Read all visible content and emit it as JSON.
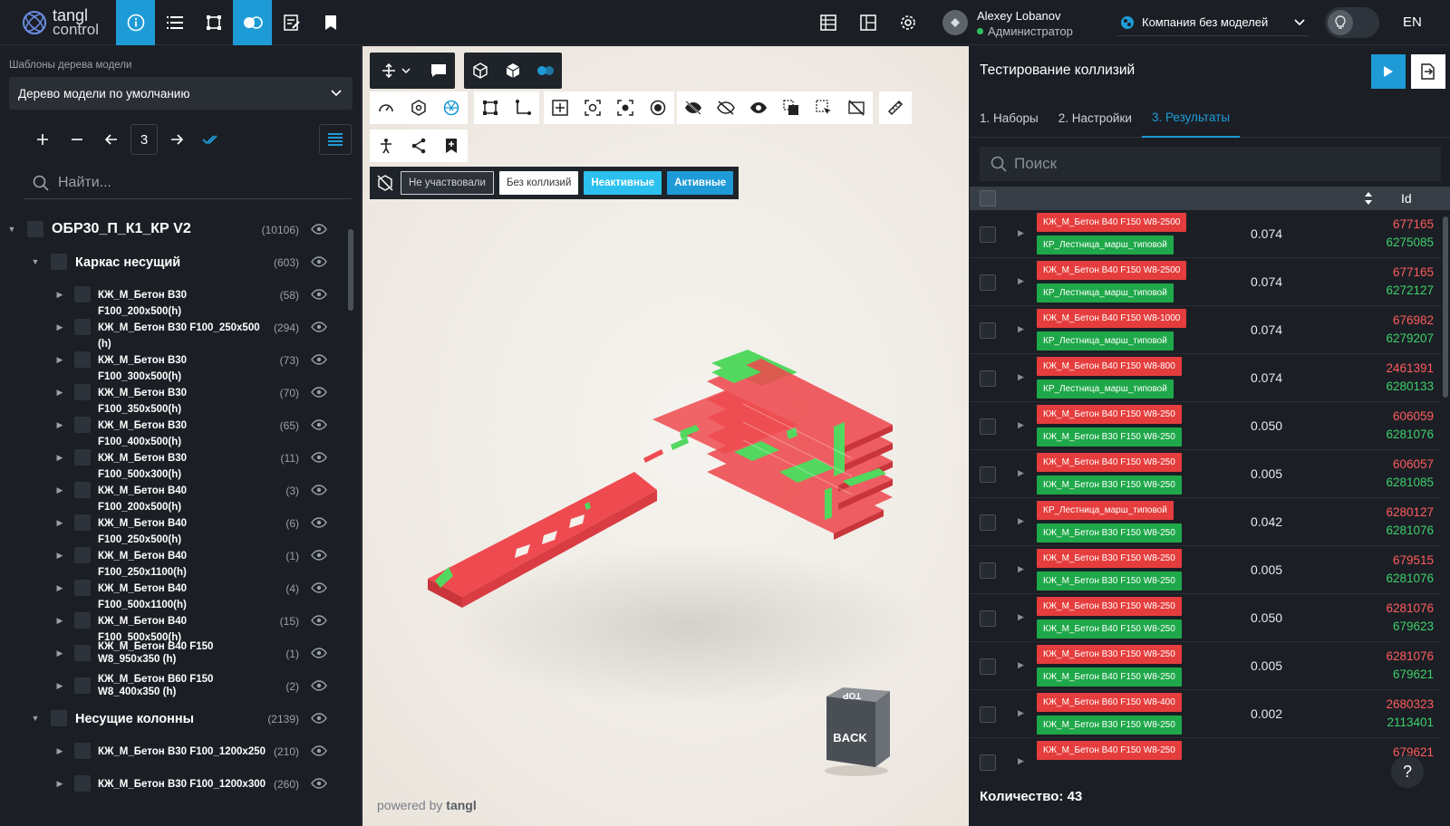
{
  "app": {
    "logo_line1": "tangl",
    "logo_line2": "control"
  },
  "user": {
    "name": "Alexey Lobanov",
    "role": "Администратор"
  },
  "company": "Компания без моделей",
  "lang": "EN",
  "left": {
    "template_label": "Шаблоны дерева модели",
    "template_value": "Дерево модели по умолчанию",
    "level": "3",
    "search_placeholder": "Найти...",
    "tree": [
      {
        "depth": 0,
        "label": "ОБР30_П_К1_КР V2",
        "count": "(10106)"
      },
      {
        "depth": 1,
        "label": "Каркас несущий",
        "count": "(603)"
      },
      {
        "depth": 2,
        "label": "КЖ_М_Бетон В30 F100_200x500(h)",
        "count": "(58)"
      },
      {
        "depth": 2,
        "label": "КЖ_М_Бетон В30 F100_250x500 (h)",
        "count": "(294)"
      },
      {
        "depth": 2,
        "label": "КЖ_М_Бетон В30 F100_300x500(h)",
        "count": "(73)"
      },
      {
        "depth": 2,
        "label": "КЖ_М_Бетон В30 F100_350x500(h)",
        "count": "(70)"
      },
      {
        "depth": 2,
        "label": "КЖ_М_Бетон В30 F100_400x500(h)",
        "count": "(65)"
      },
      {
        "depth": 2,
        "label": "КЖ_М_Бетон В30 F100_500x300(h)",
        "count": "(11)"
      },
      {
        "depth": 2,
        "label": "КЖ_М_Бетон В40 F100_200x500(h)",
        "count": "(3)"
      },
      {
        "depth": 2,
        "label": "КЖ_М_Бетон В40 F100_250x500(h)",
        "count": "(6)"
      },
      {
        "depth": 2,
        "label": "КЖ_М_Бетон В40 F100_250x1100(h)",
        "count": "(1)"
      },
      {
        "depth": 2,
        "label": "КЖ_М_Бетон В40 F100_500x1100(h)",
        "count": "(4)"
      },
      {
        "depth": 2,
        "label": "КЖ_М_Бетон В40 F100_500x500(h)",
        "count": "(15)"
      },
      {
        "depth": 2,
        "label": "КЖ_М_Бетон В40 F150 W8_950x350 (h)",
        "count": "(1)"
      },
      {
        "depth": 2,
        "label": "КЖ_М_Бетон В60 F150 W8_400x350 (h)",
        "count": "(2)"
      },
      {
        "depth": 1,
        "label": "Несущие колонны",
        "count": "(2139)"
      },
      {
        "depth": 2,
        "label": "КЖ_М_Бетон В30 F100_1200x250",
        "count": "(210)"
      },
      {
        "depth": 2,
        "label": "КЖ_М_Бетон В30 F100_1200x300",
        "count": "(260)"
      }
    ]
  },
  "viewport": {
    "filters": [
      "Не участвовали",
      "Без коллизий",
      "Неактивные",
      "Активные"
    ],
    "powered_prefix": "powered by",
    "powered_brand": "tangl",
    "cube_top": "TOP",
    "cube_face": "BACK"
  },
  "right": {
    "title": "Тестирование коллизий",
    "tabs": [
      "1. Наборы",
      "2. Настройки",
      "3. Результаты"
    ],
    "search_placeholder": "Поиск",
    "id_header": "Id",
    "rows": [
      {
        "a": "КЖ_М_Бетон В40 F150 W8-2500",
        "b": "КР_Лестница_марш_типовой",
        "d": "0.074",
        "id1": "677165",
        "id2": "6275085"
      },
      {
        "a": "КЖ_М_Бетон В40 F150 W8-2500",
        "b": "КР_Лестница_марш_типовой",
        "d": "0.074",
        "id1": "677165",
        "id2": "6272127"
      },
      {
        "a": "КЖ_М_Бетон В40 F150 W8-1000",
        "b": "КР_Лестница_марш_типовой",
        "d": "0.074",
        "id1": "676982",
        "id2": "6279207"
      },
      {
        "a": "КЖ_М_Бетон В40 F150 W8-800",
        "b": "КР_Лестница_марш_типовой",
        "d": "0.074",
        "id1": "2461391",
        "id2": "6280133"
      },
      {
        "a": "КЖ_М_Бетон В40 F150 W8-250",
        "b": "КЖ_М_Бетон В30 F150 W8-250",
        "d": "0.050",
        "id1": "606059",
        "id2": "6281076"
      },
      {
        "a": "КЖ_М_Бетон В40 F150 W8-250",
        "b": "КЖ_М_Бетон В30 F150 W8-250",
        "d": "0.005",
        "id1": "606057",
        "id2": "6281085"
      },
      {
        "a": "КР_Лестница_марш_типовой",
        "b": "КЖ_М_Бетон В30 F150 W8-250",
        "d": "0.042",
        "id1": "6280127",
        "id2": "6281076"
      },
      {
        "a": "КЖ_М_Бетон В30 F150 W8-250",
        "b": "КЖ_М_Бетон В30 F150 W8-250",
        "d": "0.005",
        "id1": "679515",
        "id2": "6281076"
      },
      {
        "a": "КЖ_М_Бетон В30 F150 W8-250",
        "b": "КЖ_М_Бетон В40 F150 W8-250",
        "d": "0.050",
        "id1": "6281076",
        "id2": "679623"
      },
      {
        "a": "КЖ_М_Бетон В30 F150 W8-250",
        "b": "КЖ_М_Бетон В40 F150 W8-250",
        "d": "0.005",
        "id1": "6281076",
        "id2": "679621"
      },
      {
        "a": "КЖ_М_Бетон В60 F150 W8-400",
        "b": "КЖ_М_Бетон В30 F150 W8-250",
        "d": "0.002",
        "id1": "2680323",
        "id2": "2113401"
      },
      {
        "a": "КЖ_М_Бетон В40 F150 W8-250",
        "b": "",
        "d": "",
        "id1": "679621",
        "id2": ""
      }
    ],
    "count_label": "Количество: 43",
    "help": "?"
  },
  "colors": {
    "accent": "#1e9bd7",
    "clash_red": "#e53d3d",
    "clash_green": "#1fa84a"
  }
}
